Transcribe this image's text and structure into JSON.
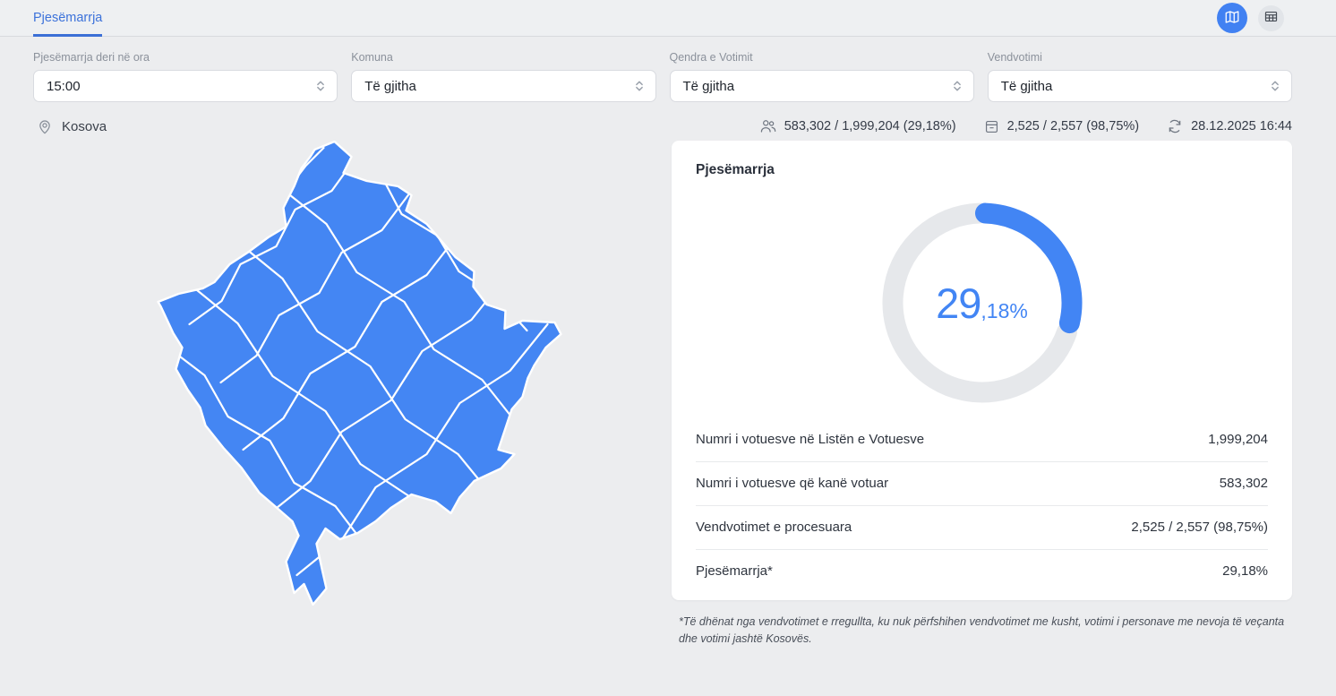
{
  "tabs": {
    "participation": "Pjesëmarrja"
  },
  "toolbar": {
    "map_view_icon": "map-icon",
    "table_view_icon": "table-icon"
  },
  "filters": [
    {
      "label": "Pjesëmarrja deri në ora",
      "value": "15:00"
    },
    {
      "label": "Komuna",
      "value": "Të gjitha"
    },
    {
      "label": "Qendra e Votimit",
      "value": "Të gjitha"
    },
    {
      "label": "Vendvotimi",
      "value": "Të gjitha"
    }
  ],
  "statusbar": {
    "location": "Kosova",
    "voters_stat": "583,302 / 1,999,204 (29,18%)",
    "polling_stat": "2,525 / 2,557 (98,75%)",
    "updated": "28.12.2025 16:44"
  },
  "card": {
    "title": "Pjesëmarrja",
    "donut": {
      "percent_main": "29",
      "percent_rest": ",18%"
    },
    "rows": [
      {
        "label": "Numri i votuesve në Listën e Votuesve",
        "value": "1,999,204"
      },
      {
        "label": "Numri i votuesve që kanë votuar",
        "value": "583,302"
      },
      {
        "label": "Vendvotimet e procesuara",
        "value": "2,525 / 2,557 (98,75%)"
      },
      {
        "label": "Pjesëmarrja*",
        "value": "29,18%"
      }
    ],
    "footnote": "*Të dhënat nga vendvotimet e rregullta, ku nuk përfshihen vendvotimet me kusht, votimi i personave me nevoja të veçanta dhe votimi jashtë Kosovës."
  },
  "chart_data": {
    "type": "pie",
    "title": "Pjesëmarrja",
    "labels": [
      "Pjesëmarrja",
      "Pjesa e mbetur"
    ],
    "values": [
      29.18,
      70.82
    ],
    "display_value": "29,18%",
    "donut": true,
    "start_angle_deg": 0,
    "colors": {
      "progress": "#4285f4",
      "track": "#e6e8eb"
    }
  },
  "colors": {
    "accent": "#4285f4",
    "map_fill": "#4486f3",
    "page_bg": "#ecedef",
    "donut_track": "#e6e8eb"
  }
}
